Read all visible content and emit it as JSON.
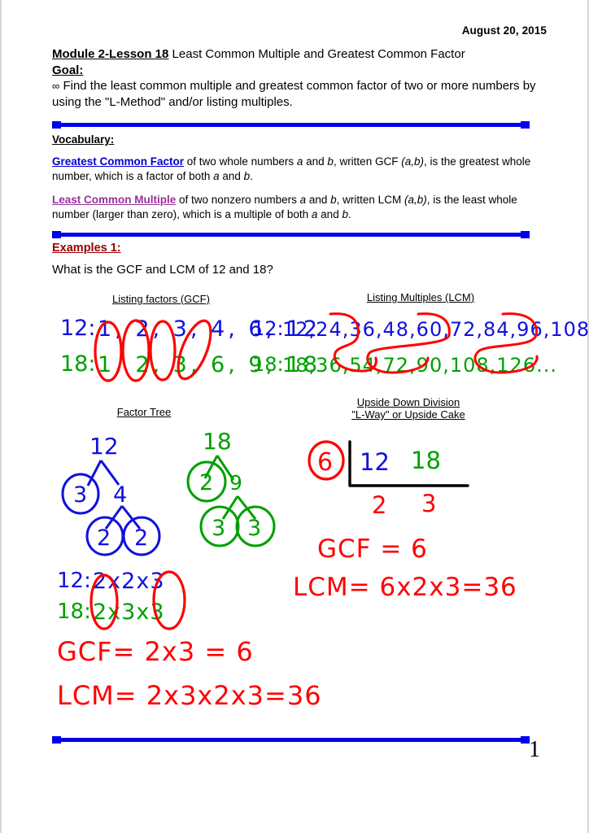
{
  "document": {
    "date": "August 20, 2015",
    "page_number": "1",
    "title_lead": "Module 2-Lesson 18",
    "title_rest": " Least Common Multiple and Greatest Common Factor",
    "goal_label": "Goal:",
    "goal_bullet": "∞",
    "goal_text": "Find the least common multiple and greatest common factor of two or more numbers by using the \"L-Method\" and/or listing multiples."
  },
  "vocabulary": {
    "heading": "Vocabulary:",
    "entries": [
      {
        "term": "Greatest Common Factor",
        "term_color": "#0000cc",
        "body_a": " of two whole numbers ",
        "var_a": "a",
        "body_b": " and ",
        "var_b": "b",
        "body_c": ", written GCF ",
        "notation": "(a,b)",
        "body_d": ", is the greatest whole number, which is a factor of both ",
        "var_c": "a",
        "body_e": " and ",
        "var_d": "b",
        "body_f": "."
      },
      {
        "term": "Least Common Multiple",
        "term_color": "#993399",
        "body_a": " of two nonzero numbers ",
        "var_a": "a",
        "body_b": " and ",
        "var_b": "b",
        "body_c": ", written LCM ",
        "notation": "(a,b)",
        "body_d": ", is the least whole number (larger than zero), which is a multiple of both ",
        "var_c": "a",
        "body_e": " and ",
        "var_d": "b",
        "body_f": "."
      }
    ]
  },
  "examples": {
    "heading": "Examples 1:",
    "question": "What is the GCF and LCM of 12 and 18?"
  },
  "colors": {
    "divider_blue": "#0000ee",
    "ink_blue": "#1111dd",
    "ink_green": "#00a000",
    "ink_red": "#ff0000",
    "ink_black": "#000000",
    "heading_maroon": "#990000",
    "link_purple": "#993399"
  },
  "work": {
    "listing_factors": {
      "label": "Listing factors (GCF)",
      "rows": [
        {
          "prefix": "12:",
          "values": "1, 2, 3, 4, 6, 12",
          "color": "#1111dd"
        },
        {
          "prefix": "18:",
          "values": "1, 2, 3, 6, 9, 18",
          "color": "#00a000"
        }
      ],
      "circled_common_factors": [
        "1",
        "2",
        "3",
        "6"
      ]
    },
    "listing_multiples": {
      "label": "Listing Multiples (LCM)",
      "rows": [
        {
          "prefix": "12:",
          "values": "12, 24, 36, 48, 60, 72, 84, 96, 108...",
          "color": "#1111dd"
        },
        {
          "prefix": "18:",
          "values": "18, 36, 54, 72, 90, 108, 126...",
          "color": "#00a000"
        }
      ],
      "circled_common_multiples": [
        "36",
        "72",
        "108"
      ]
    },
    "factor_tree": {
      "label": "Factor Tree",
      "trees": [
        {
          "root": "12",
          "branch_left": "3",
          "branch_right": "4",
          "leaf_left": "2",
          "leaf_right": "2",
          "color": "#1111dd",
          "circled": [
            "3",
            "2",
            "2"
          ]
        },
        {
          "root": "18",
          "branch_left": "2",
          "branch_right": "9",
          "leaf_left": "3",
          "leaf_right": "3",
          "color": "#00a000",
          "circled": [
            "2",
            "3",
            "3"
          ]
        }
      ]
    },
    "upside_down_division": {
      "label_line1": "Upside Down Division",
      "label_line2": "\"L-Way\" or Upside Cake",
      "divisor": "6",
      "dividend_left": "12",
      "dividend_right": "18",
      "quotient_left": "2",
      "quotient_right": "3",
      "results": [
        "GCF = 6",
        "LCM= 6x2x3=36"
      ]
    },
    "prime_factorization": {
      "rows": [
        {
          "prefix": "12:",
          "factors": "2x2x3",
          "color": "#1111dd"
        },
        {
          "prefix": "18:",
          "factors": "2x3x3",
          "color": "#00a000"
        }
      ],
      "results": [
        "GCF= 2x3 = 6",
        "LCM= 2x3x2x3=36"
      ]
    }
  }
}
